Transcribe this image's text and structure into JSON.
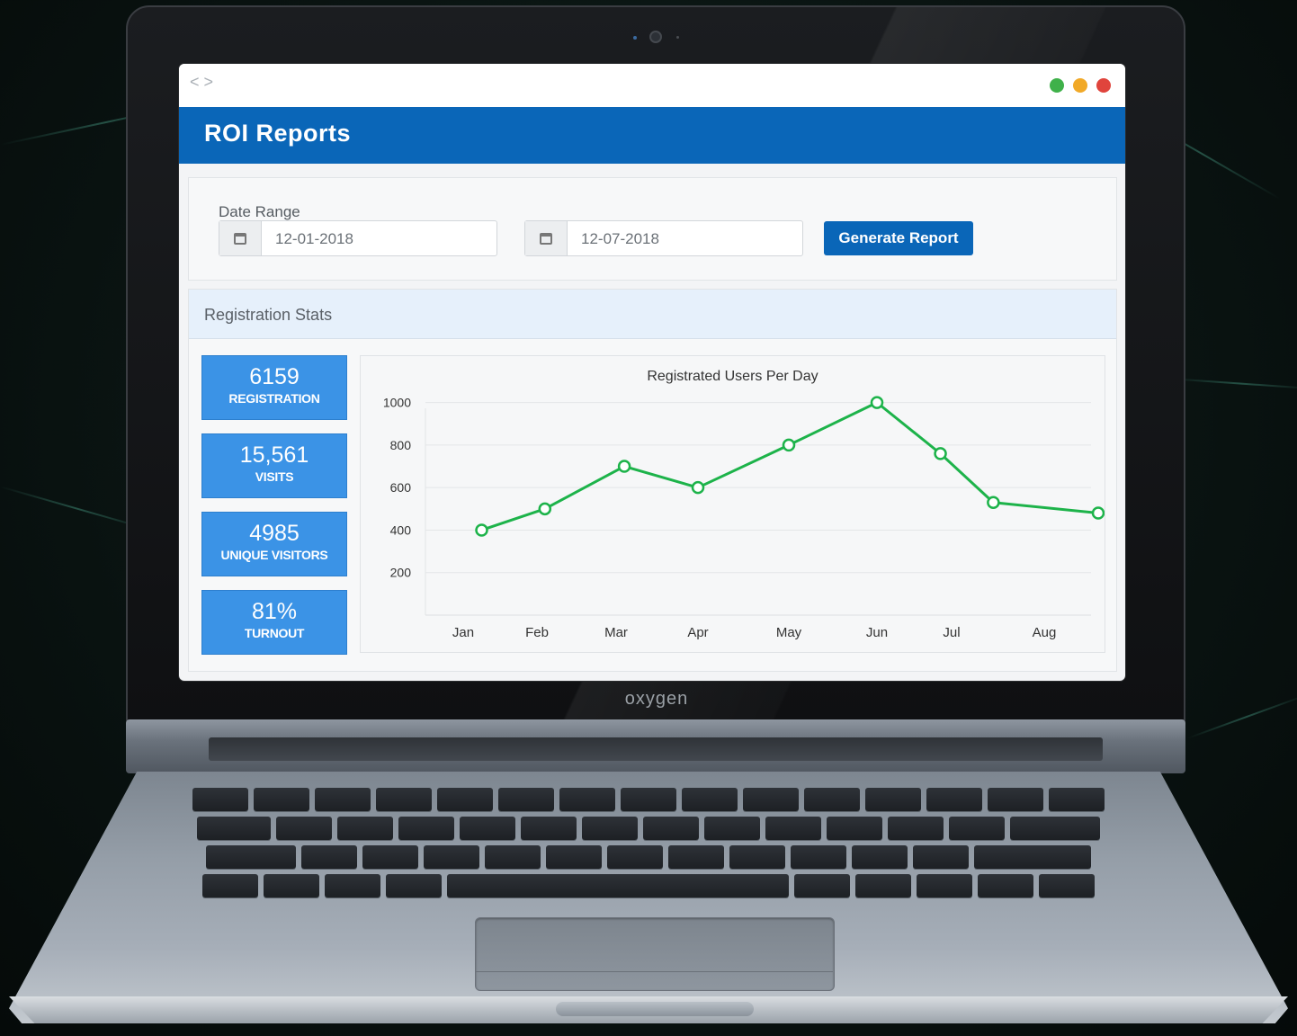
{
  "window": {
    "nav_arrows": "< >",
    "controls": [
      "close",
      "minimize",
      "maximize"
    ]
  },
  "header": {
    "title": "ROI Reports"
  },
  "filters": {
    "date_range_label": "Date Range",
    "start_date": "12-01-2018",
    "end_date": "12-07-2018",
    "generate_button": "Generate Report",
    "icon": "calendar-icon"
  },
  "stats": {
    "title": "Registration Stats",
    "cards": [
      {
        "value": "6159",
        "label": "REGISTRATION"
      },
      {
        "value": "15,561",
        "label": "VISITS"
      },
      {
        "value": "4985",
        "label": "UNIQUE VISITORS"
      },
      {
        "value": "81%",
        "label": "TURNOUT"
      }
    ]
  },
  "laptop": {
    "brand": "oxygen"
  },
  "colors": {
    "header_blue": "#0a66b8",
    "card_blue": "#3b93e6",
    "line_green": "#1db34a",
    "dot_green": "#3fb14a",
    "dot_yellow": "#f1a928",
    "dot_red": "#e0443c"
  },
  "chart_data": {
    "type": "line",
    "title": "Registrated Users Per Day",
    "categories": [
      "Jan",
      "Feb",
      "Mar",
      "Apr",
      "May",
      "Jun",
      "Jul",
      "Aug"
    ],
    "x": [
      0.25,
      1.1,
      2.1,
      3.0,
      4.0,
      5.0,
      5.85,
      6.45,
      7.6
    ],
    "values": [
      400,
      500,
      700,
      600,
      800,
      1000,
      760,
      530,
      480
    ],
    "yticks": [
      200,
      400,
      600,
      800,
      1000
    ],
    "ylim": [
      0,
      1100
    ],
    "grid": true,
    "legend": "none",
    "marker": "open-circle"
  }
}
